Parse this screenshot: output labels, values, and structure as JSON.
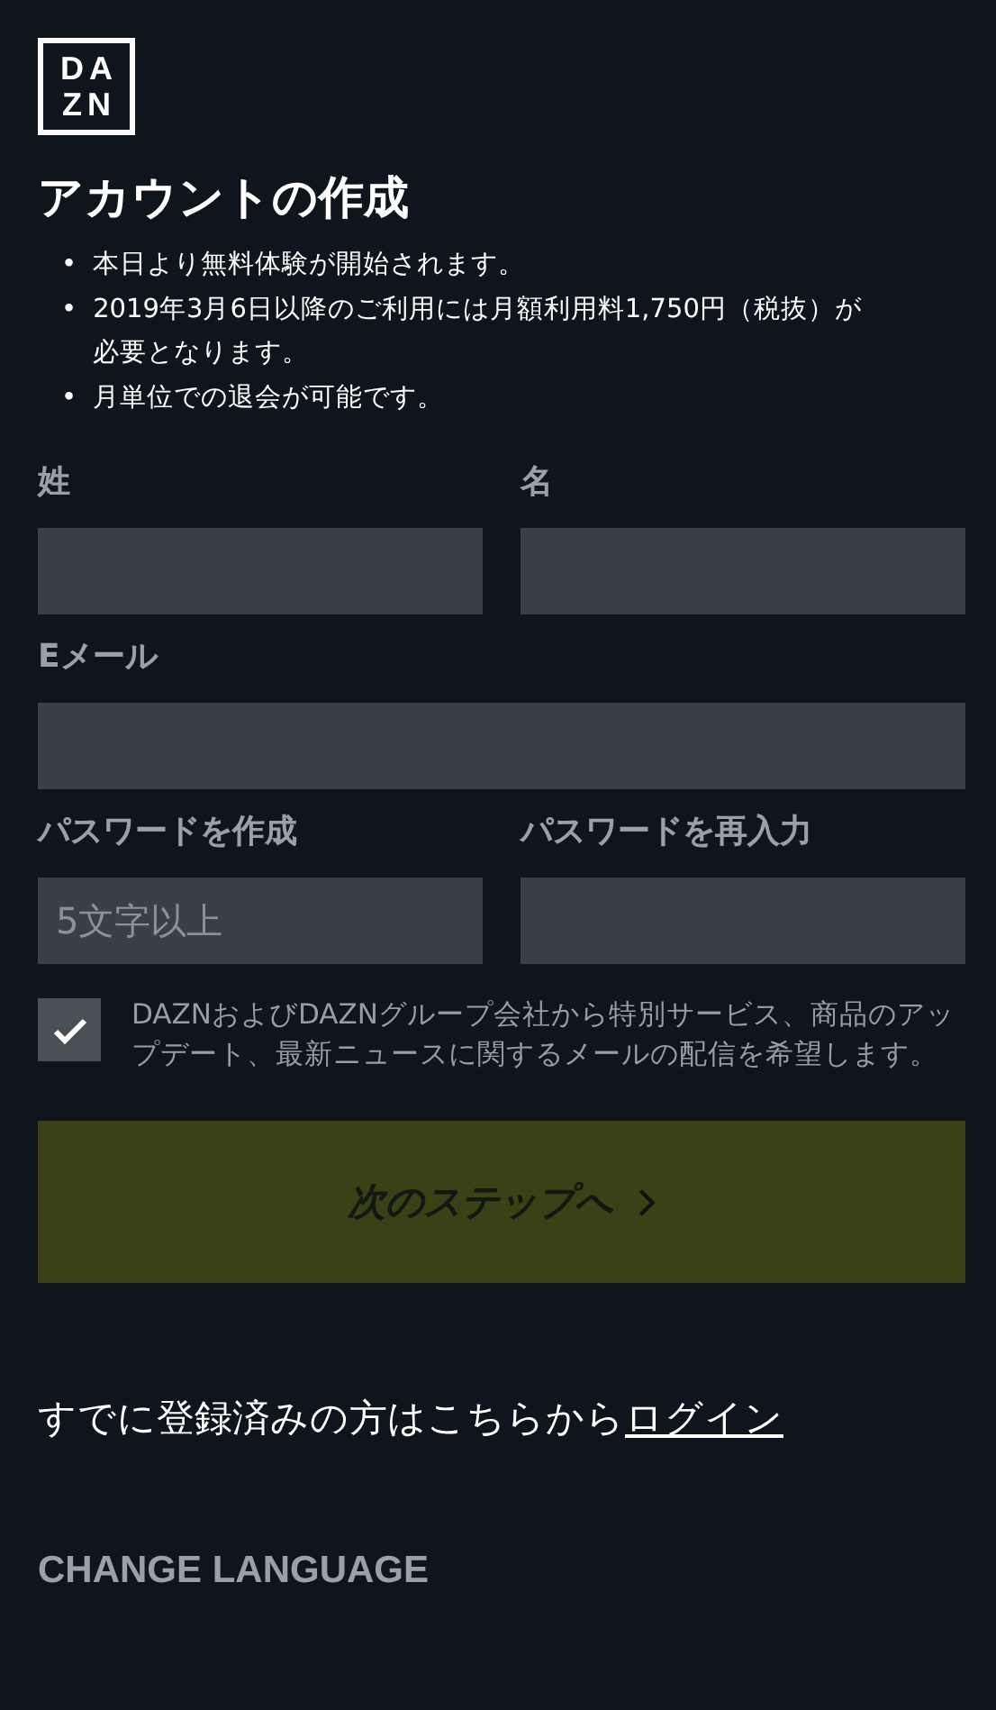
{
  "logo": {
    "lines": [
      "DA",
      "ZN"
    ]
  },
  "title": "アカウントの作成",
  "notes": [
    {
      "marker": "•",
      "text": "本日より無料体験が開始されます。"
    },
    {
      "marker": "•",
      "text": "2019年3月6日以降のご利用には月額利用料1,750円（税抜）が必要となります。"
    },
    {
      "marker": "•",
      "text": "月単位での退会が可能です。"
    }
  ],
  "fields": [
    {
      "label": "姓",
      "kind": "half"
    },
    {
      "label": "名",
      "kind": "half"
    },
    {
      "label": "Eメール",
      "kind": "full"
    },
    {
      "label": "パスワードを作成",
      "kind": "half",
      "placeholder": "5文字以上"
    },
    {
      "label": "パスワードを再入力",
      "kind": "half"
    }
  ],
  "consent": {
    "checked": true,
    "text": "DAZNおよびDAZNグループ会社から特別サービス、商品のアップデート、最新ニュースに関するメールの配信を希望します。"
  },
  "next_button": {
    "label": "次のステップへ"
  },
  "login": {
    "text": "すでに登録済みの方はこちらから",
    "link": "ログイン"
  },
  "change_language": "CHANGE LANGUAGE"
}
